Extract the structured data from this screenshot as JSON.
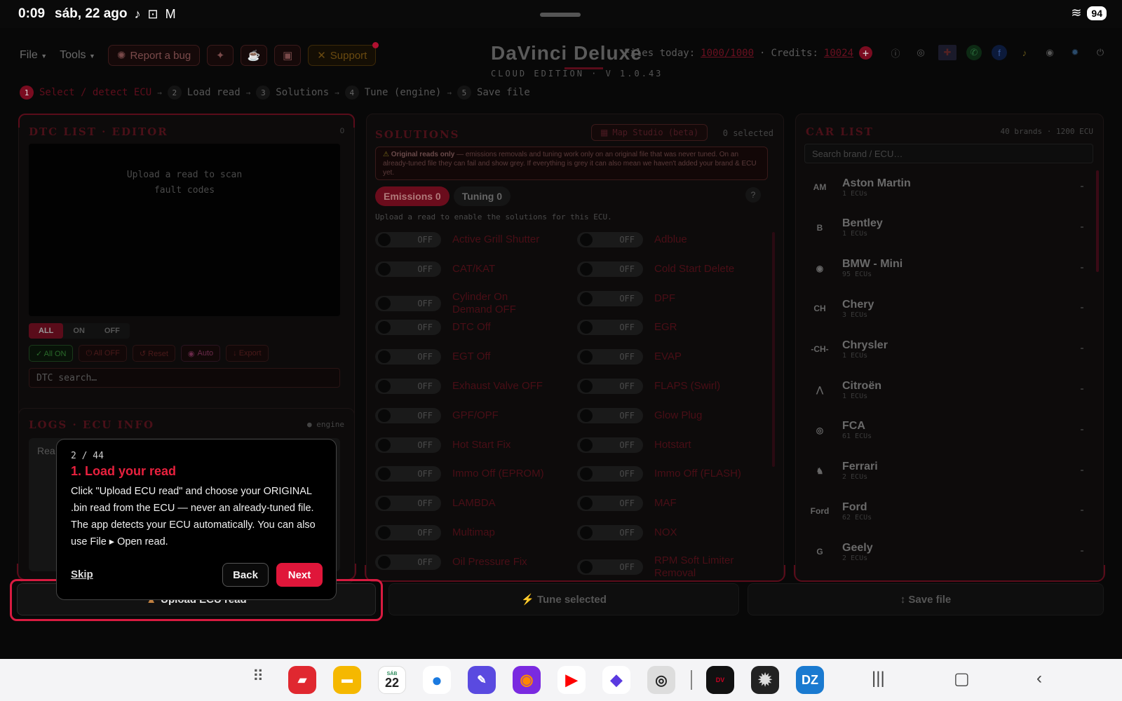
{
  "status_bar": {
    "time": "0:09",
    "date": "sáb, 22 ago",
    "battery": "94"
  },
  "menu": {
    "file": "File",
    "tools": "Tools",
    "report_bug": "Report a bug",
    "support": "Support"
  },
  "brand": {
    "title": "DaVinci Deluxe",
    "subtitle": "CLOUD EDITION · V 1.0.43"
  },
  "top_info": {
    "files_label": "Files today:",
    "files_value": "1000/1000",
    "credits_label": "Credits:",
    "credits_value": "10024"
  },
  "steps": [
    {
      "num": "1",
      "label": "Select / detect ECU"
    },
    {
      "num": "2",
      "label": "Load read"
    },
    {
      "num": "3",
      "label": "Solutions"
    },
    {
      "num": "4",
      "label": "Tune (engine)"
    },
    {
      "num": "5",
      "label": "Save file"
    }
  ],
  "dtc": {
    "title": "DTC LIST · EDITOR",
    "count": "0",
    "empty_line1": "Upload a read to scan",
    "empty_line2": "fault codes",
    "filters": [
      "ALL",
      "ON",
      "OFF"
    ],
    "actions": {
      "all_on": "✓ All ON",
      "all_off": "⏻ All OFF",
      "reset": "↺ Reset",
      "auto": "Auto",
      "export": "↓ Export"
    },
    "search_placeholder": "DTC search…"
  },
  "logs": {
    "title": "LOGS · ECU INFO",
    "tag": "● engine",
    "partial": "Rea"
  },
  "solutions": {
    "title": "SOLUTIONS",
    "map_studio": "Map Studio (beta)",
    "selected": "0 selected",
    "warning_bold": "Original reads only",
    "warning_text": " — emissions removals and tuning work only on an original file that was never tuned. On an already-tuned file they can fail and show grey. If everything is grey it can also mean we haven't added your brand & ECU yet.",
    "tab_emissions": "Emissions 0",
    "tab_tuning": "Tuning 0",
    "help": "?",
    "hint": "Upload a read to enable the solutions for this ECU.",
    "toggle_state": "OFF",
    "left": [
      "Active Grill Shutter",
      "CAT/KAT",
      "Cylinder On Demand OFF",
      "DTC Off",
      "EGT Off",
      "Exhaust Valve OFF",
      "GPF/OPF",
      "Hot Start Fix",
      "Immo Off (EPROM)",
      "LAMBDA",
      "Multimap",
      "Oil Pressure Fix"
    ],
    "right": [
      "Adblue",
      "Cold Start Delete",
      "DPF",
      "EGR",
      "EVAP",
      "FLAPS (Swirl)",
      "Glow Plug",
      "Hotstart",
      "Immo Off (FLASH)",
      "MAF",
      "NOX",
      "RPM Soft Limiter Removal"
    ]
  },
  "cars": {
    "title": "CAR LIST",
    "meta": "40 brands · 1200 ECU",
    "search_placeholder": "Search brand / ECU…",
    "items": [
      {
        "name": "Aston Martin",
        "count": "1 ECUs"
      },
      {
        "name": "Bentley",
        "count": "1 ECUs"
      },
      {
        "name": "BMW - Mini",
        "count": "95 ECUs"
      },
      {
        "name": "Chery",
        "count": "3 ECUs"
      },
      {
        "name": "Chrysler",
        "count": "1 ECUs"
      },
      {
        "name": "Citroën",
        "count": "1 ECUs"
      },
      {
        "name": "FCA",
        "count": "61 ECUs"
      },
      {
        "name": "Ferrari",
        "count": "2 ECUs"
      },
      {
        "name": "Ford",
        "count": "62 ECUs"
      },
      {
        "name": "Geely",
        "count": "2 ECUs"
      }
    ]
  },
  "bottom": {
    "upload": "Upload ECU read",
    "tune": "⚡ Tune selected",
    "save": "↕ Save file"
  },
  "tour": {
    "counter": "2 / 44",
    "title": "1. Load your read",
    "body": "Click \"Upload ECU read\" and choose your ORIGINAL .bin read from the ECU — never an already-tuned file. The app detects your ECU automatically. You can also use File ▸ Open read.",
    "skip": "Skip",
    "back": "Back",
    "next": "Next"
  },
  "dock": {
    "calendar_day": "22",
    "calendar_month": "SÁB",
    "dz": "DZ"
  },
  "colors": {
    "accent": "#e0163a",
    "highlight": "#d81b40",
    "background": "#080808"
  }
}
